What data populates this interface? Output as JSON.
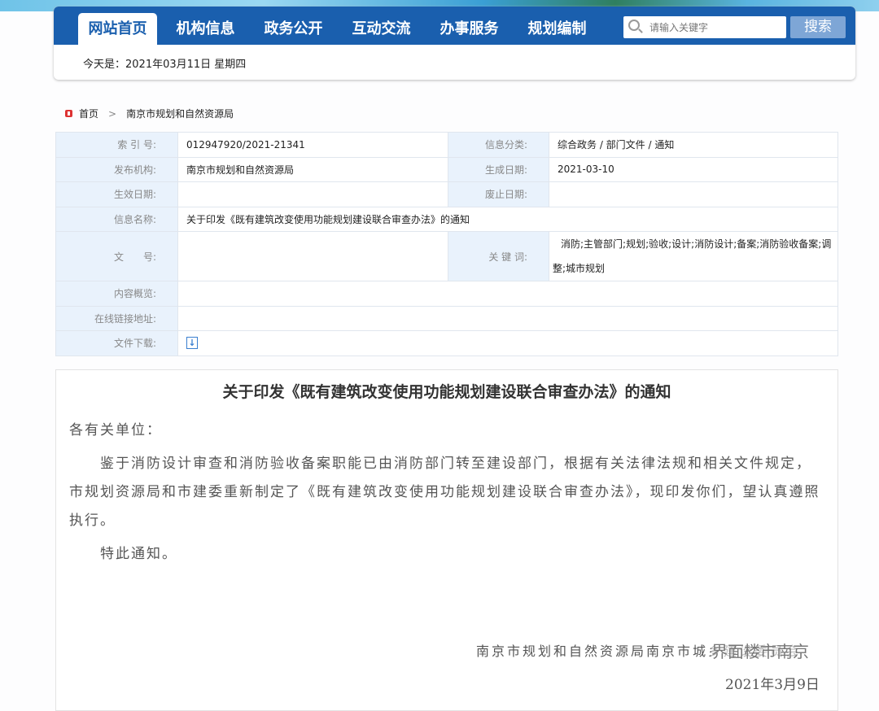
{
  "nav": {
    "tabs": [
      "网站首页",
      "机构信息",
      "政务公开",
      "互动交流",
      "办事服务",
      "规划编制"
    ],
    "search_placeholder": "请输入关键字",
    "search_button": "搜索",
    "today": "今天是：2021年03月11日 星期四"
  },
  "breadcrumb": {
    "home": "首页",
    "sep": ">",
    "current": "南京市规划和自然资源局"
  },
  "meta": {
    "index_label": "索 引 号:",
    "index": "012947920/2021-21341",
    "category_label": "信息分类:",
    "category": "综合政务 / 部门文件 / 通知",
    "publisher_label": "发布机构:",
    "publisher": "南京市规划和自然资源局",
    "created_label": "生成日期:",
    "created": "2021-03-10",
    "effective_label": "生效日期:",
    "abolish_label": "废止日期:",
    "name_label": "信息名称:",
    "name": "关于印发《既有建筑改变使用功能规划建设联合审查办法》的通知",
    "docno_label": "文　　号:",
    "keywords_label": "关 键 词:",
    "keywords": "消防;主管部门;规划;验收;设计;消防设计;备案;消防验收备案;调整;城市规划",
    "summary_label": "内容概览:",
    "link_label": "在线链接地址:",
    "download_label": "文件下载:"
  },
  "article": {
    "title": "关于印发《既有建筑改变使用功能规划建设联合审查办法》的通知",
    "salutation": "各有关单位：",
    "body": "　　鉴于消防设计审查和消防验收备案职能已由消防部门转至建设部门，根据有关法律法规和相关文件规定，市规划资源局和市建委重新制定了《既有建筑改变使用功能规划建设联合审查办法》，现印发你们，望认真遵照执行。",
    "closing": "　　特此通知。",
    "signature": "南京市规划和自然资源局南京市城乡建设委员会",
    "date": "2021年3月9日",
    "watermark": "界面楼市南京"
  }
}
